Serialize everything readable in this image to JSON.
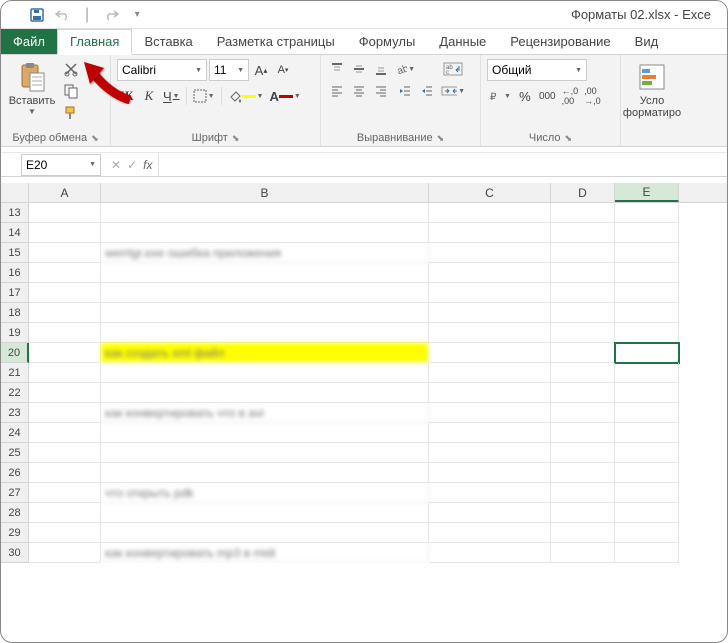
{
  "title": "Форматы 02.xlsx - Exce",
  "qat": {
    "save": "save",
    "undo": "undo",
    "redo": "redo"
  },
  "tabs": {
    "file": "Файл",
    "home": "Главная",
    "insert": "Вставка",
    "pageLayout": "Разметка страницы",
    "formulas": "Формулы",
    "data": "Данные",
    "review": "Рецензирование",
    "view": "Вид"
  },
  "ribbon": {
    "clipboard": {
      "paste": "Вставить",
      "label": "Буфер обмена"
    },
    "font": {
      "name": "Calibri",
      "size": "11",
      "bold": "Ж",
      "italic": "К",
      "underline": "Ч",
      "label": "Шрифт"
    },
    "alignment": {
      "label": "Выравнивание"
    },
    "number": {
      "format": "Общий",
      "label": "Число"
    },
    "styles": {
      "condFormat": "Усл\nформатир",
      "label": ""
    }
  },
  "formulaBar": {
    "nameBox": "E20",
    "fx": "fx",
    "value": ""
  },
  "columns": [
    "A",
    "B",
    "C",
    "D",
    "E"
  ],
  "rows": [
    {
      "n": 13,
      "b": ""
    },
    {
      "n": 14,
      "b": ""
    },
    {
      "n": 15,
      "b": "werrtgr.exe ошибка приложения"
    },
    {
      "n": 16,
      "b": ""
    },
    {
      "n": 17,
      "b": ""
    },
    {
      "n": 18,
      "b": ""
    },
    {
      "n": 19,
      "b": ""
    },
    {
      "n": 20,
      "b": "как создать xml файл",
      "hl": true
    },
    {
      "n": 21,
      "b": ""
    },
    {
      "n": 22,
      "b": ""
    },
    {
      "n": 23,
      "b": "как конвертировать что в avi"
    },
    {
      "n": 24,
      "b": ""
    },
    {
      "n": 25,
      "b": ""
    },
    {
      "n": 26,
      "b": ""
    },
    {
      "n": 27,
      "b": "что открыть pdk"
    },
    {
      "n": 28,
      "b": ""
    },
    {
      "n": 29,
      "b": ""
    },
    {
      "n": 30,
      "b": "как конвертировать mp3 в midi"
    }
  ],
  "activeCell": {
    "row": 20,
    "col": "E"
  }
}
